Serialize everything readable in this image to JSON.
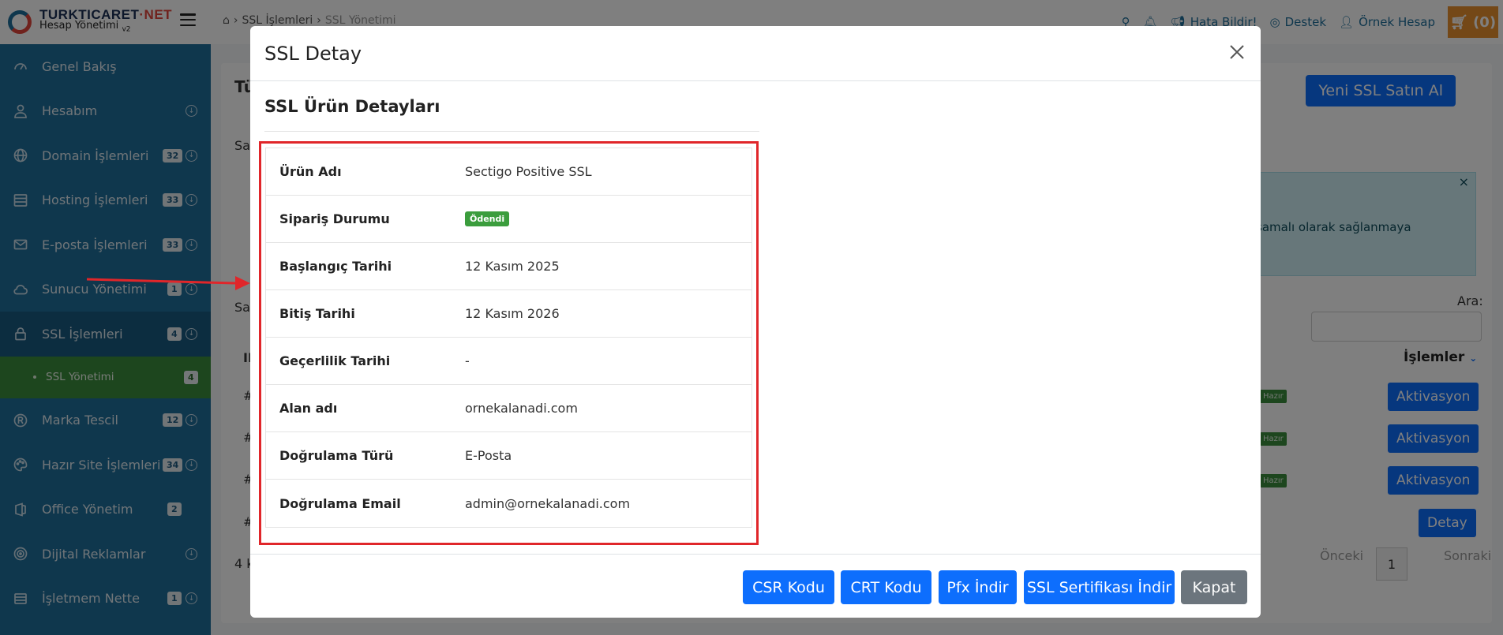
{
  "brand": {
    "name_main": "TURKTICARET",
    "name_accent": "·NET",
    "subtitle": "Hesap Yönetimi",
    "version": "v2"
  },
  "sidebar": {
    "items": [
      {
        "label": "Genel Bakış",
        "badge": null,
        "has_arrow": false,
        "icon": "dashboard-icon"
      },
      {
        "label": "Hesabım",
        "badge": null,
        "has_arrow": true,
        "icon": "user-icon"
      },
      {
        "label": "Domain İşlemleri",
        "badge": "32",
        "has_arrow": true,
        "icon": "globe-icon"
      },
      {
        "label": "Hosting İşlemleri",
        "badge": "33",
        "has_arrow": true,
        "icon": "server-icon"
      },
      {
        "label": "E-posta İşlemleri",
        "badge": "33",
        "has_arrow": true,
        "icon": "mail-icon"
      },
      {
        "label": "Sunucu Yönetimi",
        "badge": "1",
        "has_arrow": true,
        "icon": "cloud-icon"
      },
      {
        "label": "SSL İşlemleri",
        "badge": "4",
        "has_arrow": true,
        "icon": "lock-icon"
      },
      {
        "label": "Marka Tescil",
        "badge": "12",
        "has_arrow": true,
        "icon": "registered-icon"
      },
      {
        "label": "Hazır Site İşlemleri",
        "badge": "34",
        "has_arrow": true,
        "icon": "palette-icon"
      },
      {
        "label": "Office Yönetim",
        "badge": "2",
        "has_arrow": false,
        "icon": "office-icon"
      },
      {
        "label": "Dijital Reklamlar",
        "badge": null,
        "has_arrow": true,
        "icon": "target-icon"
      },
      {
        "label": "İşletmem Nette",
        "badge": "1",
        "has_arrow": true,
        "icon": "store-icon"
      }
    ],
    "subitem": {
      "label": "SSL Yönetimi",
      "badge": "4"
    }
  },
  "topbar": {
    "breadcrumb": [
      "SSL İşlemleri",
      "SSL Yönetimi"
    ],
    "report_bug": "Hata Bildir!",
    "support": "Destek",
    "account": "Örnek Hesap",
    "cart": "(0)"
  },
  "page": {
    "title_partial": "Tü",
    "new_ssl_button": "Yeni SSL Satın Al",
    "info_text": "şamalı olarak sağlanmaya",
    "search_label": "Ara:",
    "col_actions": "İşlemler",
    "row_actions": [
      "Aktivasyon",
      "Aktivasyon",
      "Aktivasyon",
      "Detay"
    ],
    "status_ready": "Hazır",
    "prev": "Önceki",
    "page_number": "1",
    "next": "Sonraki",
    "left_fragments": {
      "s1": "Sa",
      "s2": "Sa",
      "th": "II",
      "r": "#",
      "count": "4 k"
    }
  },
  "modal": {
    "title": "SSL Detay",
    "section_title": "SSL Ürün Detayları",
    "rows": [
      {
        "label": "Ürün Adı",
        "value": "Sectigo Positive SSL"
      },
      {
        "label": "Sipariş Durumu",
        "value": "Ödendi",
        "is_badge": true
      },
      {
        "label": "Başlangıç Tarihi",
        "value": "12 Kasım 2025"
      },
      {
        "label": "Bitiş Tarihi",
        "value": "12 Kasım 2026"
      },
      {
        "label": "Geçerlilik Tarihi",
        "value": "-"
      },
      {
        "label": "Alan adı",
        "value": "ornekalanadi.com"
      },
      {
        "label": "Doğrulama Türü",
        "value": "E-Posta"
      },
      {
        "label": "Doğrulama Email",
        "value": "admin@ornekalanadi.com"
      }
    ],
    "buttons": {
      "csr": "CSR Kodu",
      "crt": "CRT Kodu",
      "pfx": "Pfx İndir",
      "ssl_download": "SSL Sertifikası İndir",
      "close": "Kapat"
    }
  },
  "colors": {
    "primary": "#0d6efd",
    "sidebar": "#1e6e9a",
    "success": "#3b8d3d",
    "annotation": "#e0262a",
    "cart": "#e8912e"
  }
}
